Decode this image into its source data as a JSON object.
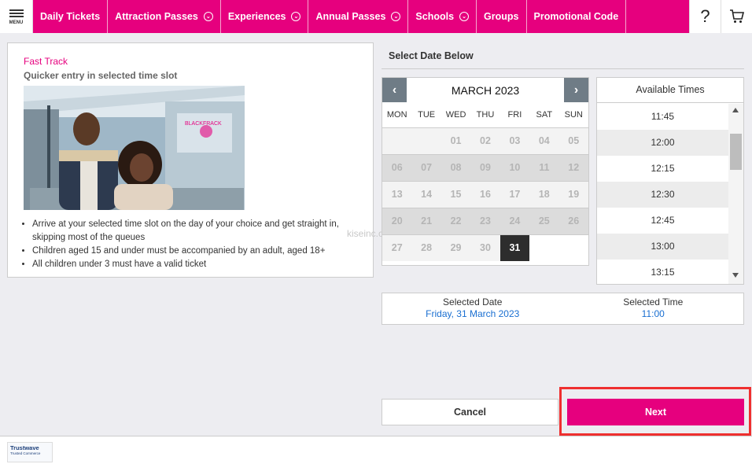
{
  "nav": {
    "menu_label": "MENU",
    "items": [
      {
        "label": "Daily Tickets",
        "dropdown": false
      },
      {
        "label": "Attraction Passes",
        "dropdown": true
      },
      {
        "label": "Experiences",
        "dropdown": true
      },
      {
        "label": "Annual Passes",
        "dropdown": true
      },
      {
        "label": "Schools",
        "dropdown": true
      },
      {
        "label": "Groups",
        "dropdown": false
      },
      {
        "label": "Promotional Code",
        "dropdown": false
      }
    ],
    "help_icon": "?",
    "cart_icon": "cart-icon",
    "accent_color": "#e6007e"
  },
  "product": {
    "title": "Fast Track",
    "subtitle": "Quicker entry in selected time slot",
    "image": "couple-at-attraction-photo",
    "bullets": [
      "Arrive at your selected time slot on the day of your choice and get straight in, skipping most of the queues",
      "Children aged 15 and under must be accompanied by an adult, aged 18+",
      "All children under 3 must have a valid ticket"
    ]
  },
  "watermark": "kiseinc.com",
  "date_section": {
    "heading": "Select Date Below"
  },
  "calendar": {
    "month": "MARCH 2023",
    "prev": "‹",
    "next": "›",
    "weekdays": [
      "MON",
      "TUE",
      "WED",
      "THU",
      "FRI",
      "SAT",
      "SUN"
    ],
    "rows": [
      [
        "",
        "",
        "01",
        "02",
        "03",
        "04",
        "05"
      ],
      [
        "06",
        "07",
        "08",
        "09",
        "10",
        "11",
        "12"
      ],
      [
        "13",
        "14",
        "15",
        "16",
        "17",
        "18",
        "19"
      ],
      [
        "20",
        "21",
        "22",
        "23",
        "24",
        "25",
        "26"
      ],
      [
        "27",
        "28",
        "29",
        "30",
        "31",
        "",
        ""
      ]
    ],
    "selected_day": "31"
  },
  "times": {
    "heading": "Available Times",
    "slots": [
      "11:45",
      "12:00",
      "12:15",
      "12:30",
      "12:45",
      "13:00",
      "13:15"
    ]
  },
  "summary": {
    "date_label": "Selected Date",
    "date_value": "Friday, 31 March 2023",
    "time_label": "Selected Time",
    "time_value": "11:00",
    "value_color": "#1a6fd1"
  },
  "actions": {
    "cancel": "Cancel",
    "next": "Next"
  },
  "footer": {
    "badge_title": "Trustwave",
    "badge_sub": "Trusted Commerce"
  }
}
